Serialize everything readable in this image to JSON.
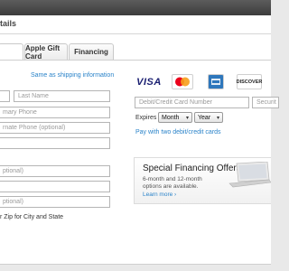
{
  "header": {
    "title": "tails"
  },
  "tabs": [
    {
      "label": "Apple Gift Card"
    },
    {
      "label": "Financing"
    }
  ],
  "billing": {
    "same_as_shipping": "Same as shipping information",
    "last_name_placeholder": "Last Name",
    "primary_phone_placeholder": "mary Phone",
    "alternate_phone_placeholder": "rnate Phone (optional)",
    "optional_field_1": "ptional)",
    "optional_field_2": "ptional)",
    "zip_hint": "r Zip for City and State"
  },
  "payment": {
    "card_brands": [
      {
        "name": "VISA",
        "icon": "visa-icon"
      },
      {
        "name": "MasterCard",
        "icon": "mastercard-icon"
      },
      {
        "name": "American Express",
        "icon": "amex-icon"
      },
      {
        "name": "DISCOVER",
        "icon": "discover-icon"
      }
    ],
    "card_number_placeholder": "Debit/Credit Card Number",
    "security_placeholder": "Securit",
    "expires_label": "Expires",
    "month_label": "Month",
    "year_label": "Year",
    "two_cards_link": "Pay with two debit/credit cards"
  },
  "promo": {
    "title": "Special Financing Offers",
    "body": "6-month and 12-month options are available.",
    "link": "Learn more ›"
  },
  "colors": {
    "link": "#2a83c9",
    "visa": "#1a1f71",
    "mastercard_red": "#eb001b",
    "mastercard_orange": "#f79e1b",
    "amex": "#2e77bc",
    "discover": "#f58220"
  }
}
